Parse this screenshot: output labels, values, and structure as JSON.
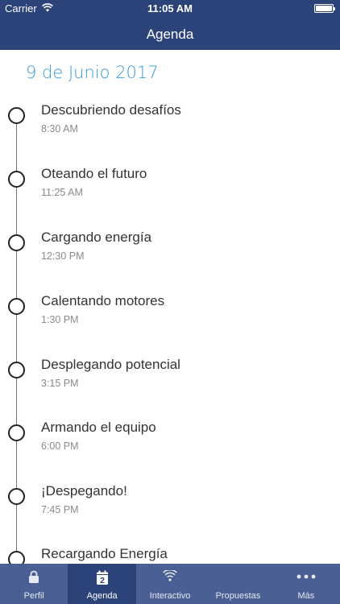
{
  "status": {
    "carrier": "Carrier",
    "time": "11:05 AM"
  },
  "nav": {
    "title": "Agenda"
  },
  "date": "9 de Junio 2017",
  "events": [
    {
      "title": "Descubriendo desafíos",
      "time": "8:30 AM"
    },
    {
      "title": "Oteando el futuro",
      "time": "11:25 AM"
    },
    {
      "title": "Cargando energía",
      "time": "12:30 PM"
    },
    {
      "title": "Calentando motores",
      "time": "1:30 PM"
    },
    {
      "title": "Desplegando potencial",
      "time": "3:15 PM"
    },
    {
      "title": "Armando el equipo",
      "time": "6:00 PM"
    },
    {
      "title": "¡Despegando!",
      "time": "7:45 PM"
    },
    {
      "title": "Recargando Energía",
      "time": ""
    }
  ],
  "tabs": [
    {
      "label": "Perfil",
      "icon": "lock-icon"
    },
    {
      "label": "Agenda",
      "icon": "calendar-icon",
      "icon_text": "2"
    },
    {
      "label": "Interactivo",
      "icon": "wifi-icon"
    },
    {
      "label": "Propuestas",
      "icon": ""
    },
    {
      "label": "Más",
      "icon": "more-icon"
    }
  ],
  "colors": {
    "navbar": "#2c4379",
    "tabbar": "#4a5f93",
    "accent": "#3a9ad9"
  }
}
